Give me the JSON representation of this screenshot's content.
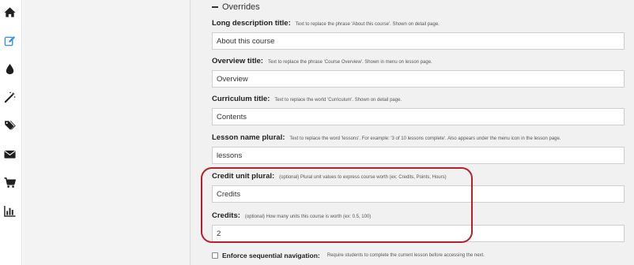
{
  "sidebar": {
    "items": [
      {
        "icon": "home-icon",
        "active": false
      },
      {
        "icon": "edit-icon",
        "active": true
      },
      {
        "icon": "drop-icon",
        "active": false
      },
      {
        "icon": "magic-wand-icon",
        "active": false
      },
      {
        "icon": "tags-icon",
        "active": false
      },
      {
        "icon": "envelope-icon",
        "active": false
      },
      {
        "icon": "cart-icon",
        "active": false
      },
      {
        "icon": "bar-chart-icon",
        "active": false
      }
    ],
    "colors": {
      "default": "#1f1f1f",
      "active": "#3a93d8"
    }
  },
  "overrides": {
    "title": "Overrides"
  },
  "fields": {
    "long_description": {
      "label": "Long description title:",
      "help": "Text to replace the phrase 'About this course'. Shown on detail page.",
      "value": "About this course"
    },
    "overview": {
      "label": "Overview title:",
      "help": "Text to replace the phrase 'Course Overview'. Shown in menu on lesson page.",
      "value": "Overview"
    },
    "curriculum": {
      "label": "Curriculum title:",
      "help": "Text to replace the world 'Curriculum'. Shown on detail page.",
      "value": "Contents"
    },
    "lesson_plural": {
      "label": "Lesson name plural:",
      "help": "Text to replace the word 'lessons'. For example: '3 of 10 lessons complete'. Also appears under the menu icon in the lesson page.",
      "value": "lessons"
    },
    "credit_unit_plural": {
      "label": "Credit unit plural:",
      "help": "(optional) Plural unit values to express course worth (ex: Credits, Points, Hours)",
      "value": "Credits"
    },
    "credits": {
      "label": "Credits:",
      "help": "(optional) How many units this course is worth (ex: 0.5, 100)",
      "value": "2"
    }
  },
  "sequential": {
    "label": "Enforce sequential navigation:",
    "help": "Require students to complete the current lesson before accessing the next.",
    "checked": false
  },
  "highlight_color": "#b5202a"
}
